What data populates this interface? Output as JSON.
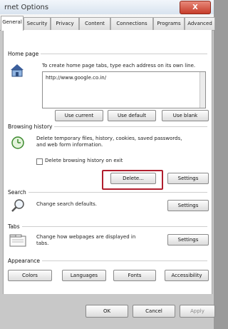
{
  "window": {
    "title": "rnet Options",
    "close_label": "X"
  },
  "tabs": [
    {
      "label": "General",
      "active": true
    },
    {
      "label": "Security"
    },
    {
      "label": "Privacy"
    },
    {
      "label": "Content"
    },
    {
      "label": "Connections"
    },
    {
      "label": "Programs"
    },
    {
      "label": "Advanced"
    }
  ],
  "home_page": {
    "section_label": "Home page",
    "description": "To create home page tabs, type each address on its own line.",
    "url": "http://www.google.co.in/",
    "buttons": {
      "use_current": "Use current",
      "use_default": "Use default",
      "use_blank": "Use blank"
    }
  },
  "browsing_history": {
    "section_label": "Browsing history",
    "description_line1": "Delete temporary files, history, cookies, saved passwords,",
    "description_line2": "and web form information.",
    "checkbox_label": "Delete browsing history on exit",
    "buttons": {
      "delete": "Delete...",
      "settings": "Settings"
    }
  },
  "search": {
    "section_label": "Search",
    "description": "Change search defaults.",
    "buttons": {
      "settings": "Settings"
    }
  },
  "tabs_section": {
    "section_label": "Tabs",
    "description_line1": "Change how webpages are displayed in",
    "description_line2": "tabs.",
    "buttons": {
      "settings": "Settings"
    }
  },
  "appearance": {
    "section_label": "Appearance",
    "buttons": {
      "colors": "Colors",
      "languages": "Languages",
      "fonts": "Fonts",
      "accessibility": "Accessibility"
    }
  },
  "dialog_buttons": {
    "ok": "OK",
    "cancel": "Cancel",
    "apply": "Apply"
  },
  "colors": {
    "highlight": "#b11e2e",
    "close": "#c63c2a"
  }
}
